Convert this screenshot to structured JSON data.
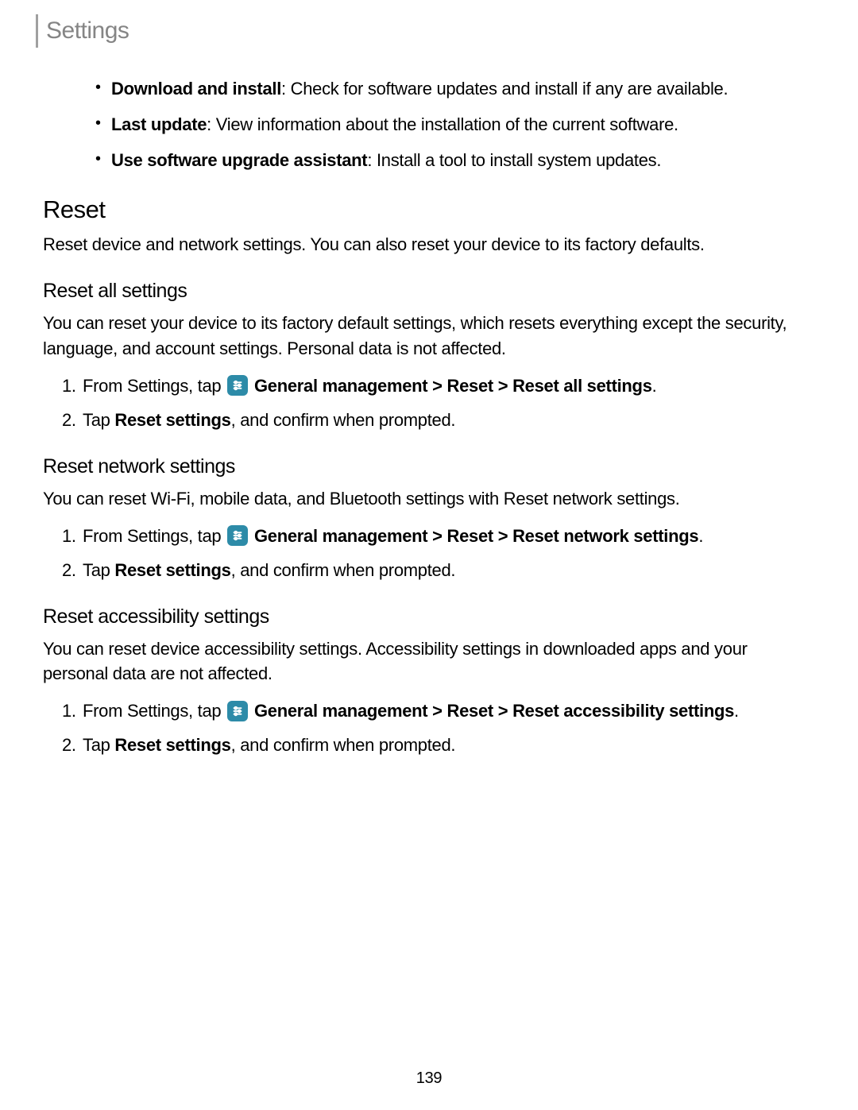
{
  "header": {
    "title": "Settings"
  },
  "bullets": [
    {
      "bold": "Download and install",
      "text": ": Check for software updates and install if any are available."
    },
    {
      "bold": "Last update",
      "text": ": View information about the installation of the current software."
    },
    {
      "bold": "Use software upgrade assistant",
      "text": ": Install a tool to install system updates."
    }
  ],
  "reset": {
    "heading": "Reset",
    "desc": "Reset device and network settings. You can also reset your device to its factory defaults."
  },
  "reset_all": {
    "heading": "Reset all settings",
    "desc": "You can reset your device to its factory default settings, which resets everything except the security, language, and account settings. Personal data is not affected.",
    "step1_pre": "From Settings, tap ",
    "step1_bold": "General management > Reset > Reset all settings",
    "step1_end": ".",
    "step2_pre": "Tap ",
    "step2_bold": "Reset settings",
    "step2_post": ", and confirm when prompted."
  },
  "reset_network": {
    "heading": "Reset network settings",
    "desc": "You can reset Wi-Fi, mobile data, and Bluetooth settings with Reset network settings.",
    "step1_pre": "From Settings, tap ",
    "step1_bold": "General management > Reset > Reset network settings",
    "step1_end": ".",
    "step2_pre": "Tap ",
    "step2_bold": "Reset settings",
    "step2_post": ", and confirm when prompted."
  },
  "reset_accessibility": {
    "heading": "Reset accessibility settings",
    "desc": "You can reset device accessibility settings. Accessibility settings in downloaded apps and your personal data are not affected.",
    "step1_pre": "From Settings, tap ",
    "step1_bold": "General management > Reset > Reset accessibility settings",
    "step1_end": ".",
    "step2_pre": "Tap ",
    "step2_bold": "Reset settings",
    "step2_post": ", and confirm when prompted."
  },
  "page_number": "139",
  "numbers": {
    "one": "1.",
    "two": "2."
  }
}
